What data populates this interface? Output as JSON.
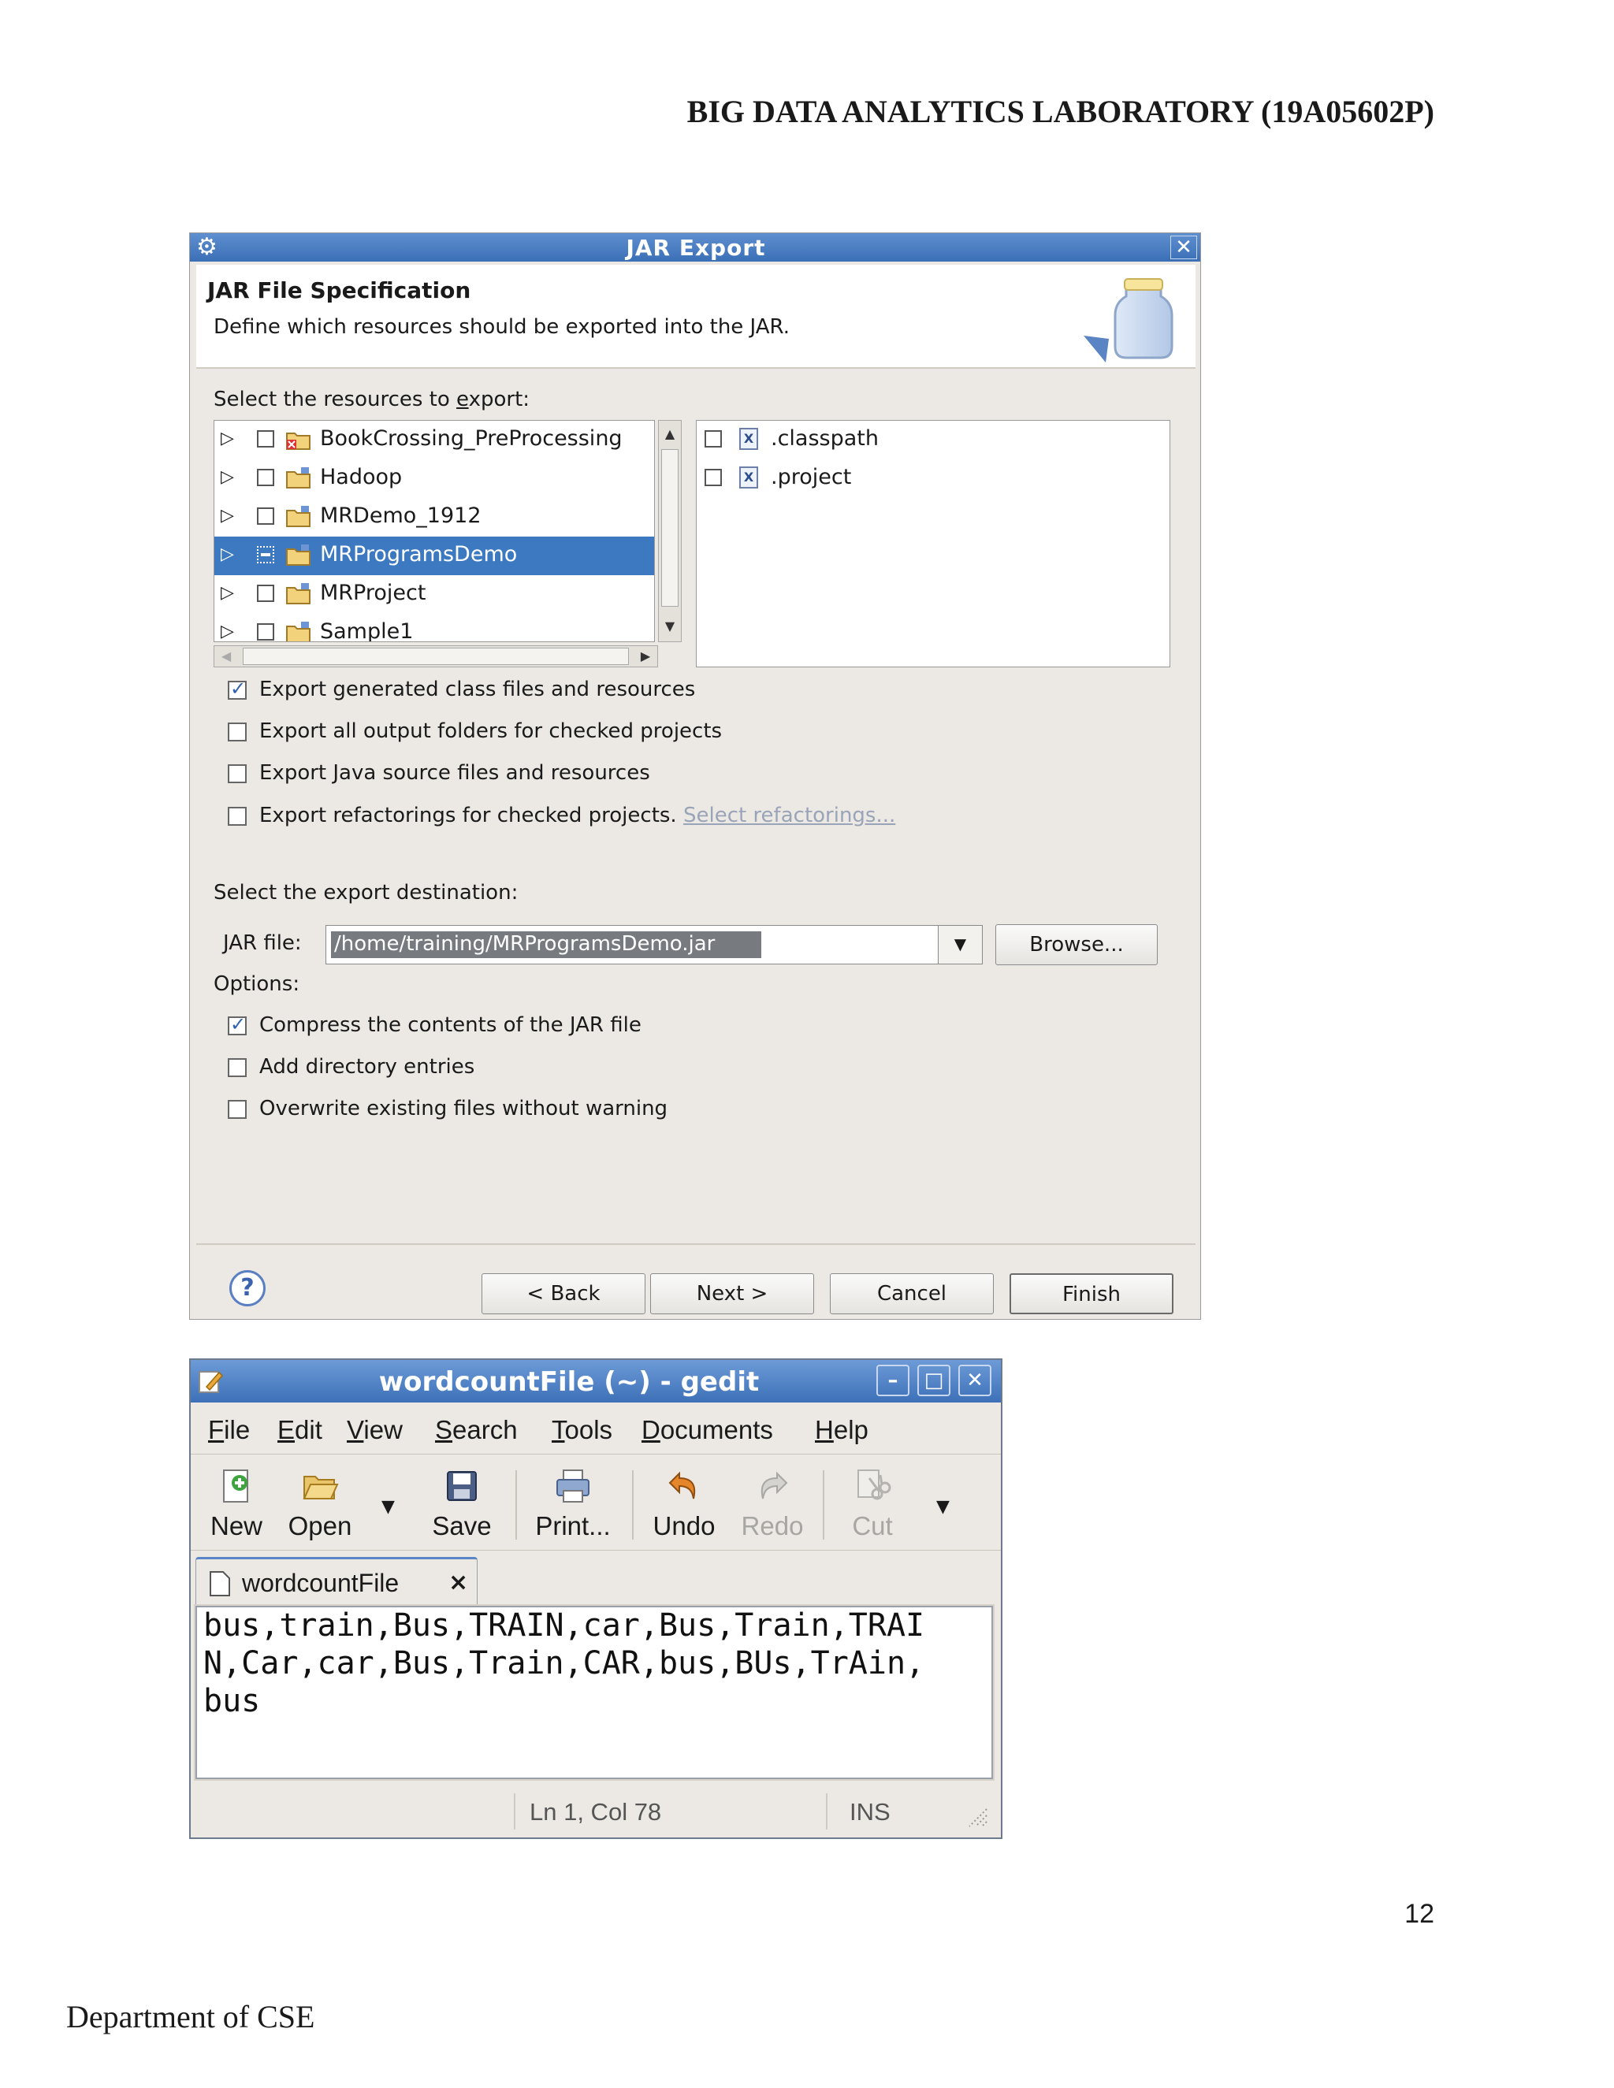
{
  "document": {
    "header": "BIG DATA ANALYTICS LABORATORY (19A05602P)",
    "page_number": "12",
    "footer": "Department of CSE"
  },
  "jar_dialog": {
    "title": "JAR Export",
    "banner_title": "JAR File Specification",
    "banner_description": "Define which resources should be exported into the JAR.",
    "resources_label": "Select the resources to export:",
    "projects": [
      {
        "label": "BookCrossing_PreProcessing",
        "selected": false,
        "error": true
      },
      {
        "label": "Hadoop",
        "selected": false
      },
      {
        "label": "MRDemo_1912",
        "selected": false
      },
      {
        "label": "MRProgramsDemo",
        "selected": true
      },
      {
        "label": "MRProject",
        "selected": false
      },
      {
        "label": "Sample1",
        "selected": false
      }
    ],
    "files": [
      {
        "label": ".classpath"
      },
      {
        "label": ".project"
      }
    ],
    "export_options": [
      {
        "label": "Export generated class files and resources",
        "checked": true
      },
      {
        "label": "Export all output folders for checked projects",
        "checked": false
      },
      {
        "label": "Export Java source files and resources",
        "checked": false
      },
      {
        "label": "Export refactorings for checked projects.",
        "checked": false
      }
    ],
    "select_refactorings_link": "Select refactorings...",
    "destination_label": "Select the export destination:",
    "jar_file_label": "JAR file:",
    "jar_file_value": "/home/training/MRProgramsDemo.jar",
    "browse_button": "Browse...",
    "options_label": "Options:",
    "jar_options": [
      {
        "label": "Compress the contents of the JAR file",
        "checked": true
      },
      {
        "label": "Add directory entries",
        "checked": false
      },
      {
        "label": "Overwrite existing files without warning",
        "checked": false
      }
    ],
    "buttons": {
      "back": "< Back",
      "next": "Next >",
      "cancel": "Cancel",
      "finish": "Finish"
    }
  },
  "gedit": {
    "title": "wordcountFile (~) - gedit",
    "menu": [
      "File",
      "Edit",
      "View",
      "Search",
      "Tools",
      "Documents",
      "Help"
    ],
    "toolbar": {
      "new": "New",
      "open": "Open",
      "save": "Save",
      "print": "Print...",
      "undo": "Undo",
      "redo": "Redo",
      "cut": "Cut"
    },
    "tab_label": "wordcountFile",
    "content_lines": [
      "bus,train,Bus,TRAIN,car,Bus,Train,TRAI",
      "N,Car,car,Bus,Train,CAR,bus,BUs,TrAin,",
      "bus"
    ],
    "status": {
      "position": "Ln 1, Col 78",
      "mode": "INS"
    }
  }
}
